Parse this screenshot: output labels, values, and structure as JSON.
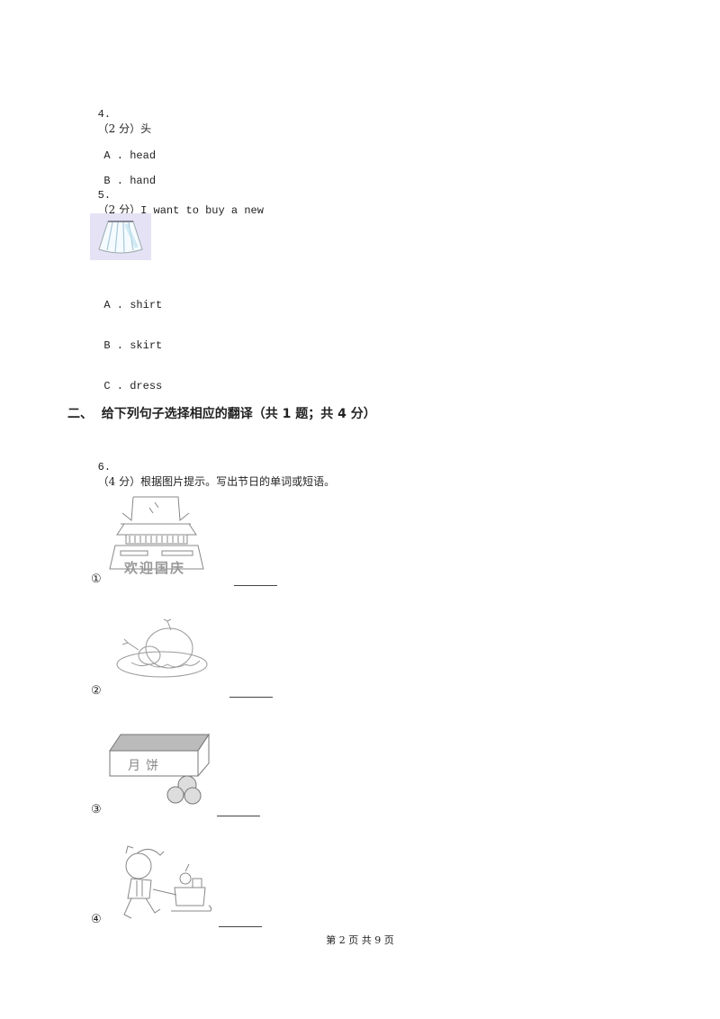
{
  "questions": [
    {
      "number": "4.",
      "score": "（2 分）",
      "prompt": "头",
      "options": [
        {
          "letter": "A .",
          "text": "head"
        },
        {
          "letter": "B .",
          "text": "hand"
        }
      ]
    },
    {
      "number": "5.",
      "score": "（2 分）",
      "prompt": "I want to buy a new",
      "tail": ".  （    ）",
      "image": "skirt-picture",
      "options": [
        {
          "letter": "A .",
          "text": "shirt"
        },
        {
          "letter": "B .",
          "text": "skirt"
        },
        {
          "letter": "C .",
          "text": "dress"
        }
      ]
    }
  ],
  "section2": {
    "title": "二、  给下列句子选择相应的翻译（共 1 题；共 4 分）"
  },
  "question6": {
    "number": "6.",
    "score": "（4 分）",
    "prompt": "根据图片提示。写出节日的单词或短语。",
    "items": [
      {
        "marker": "①",
        "image": "national-day-gate-picture",
        "caption": "欢迎国庆",
        "answer": ""
      },
      {
        "marker": "②",
        "image": "roast-turkey-picture",
        "answer": ""
      },
      {
        "marker": "③",
        "image": "mooncake-box-picture",
        "caption": "月饼",
        "answer": ""
      },
      {
        "marker": "④",
        "image": "santa-sleigh-picture",
        "answer": ""
      }
    ]
  },
  "footer": {
    "page_text": "第 2 页 共 9 页"
  }
}
